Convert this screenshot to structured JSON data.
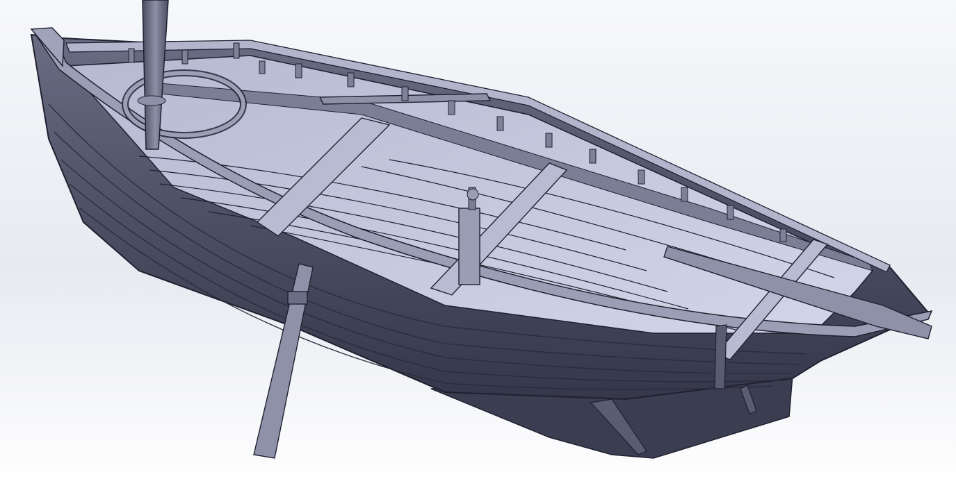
{
  "viewport": {
    "model": "boat",
    "view": "3d-shaded",
    "background": "gradient",
    "colors": {
      "hull_dark": "#3d3f52",
      "hull_mid": "#5b5e73",
      "hull_light": "#8e91a8",
      "deck": "#c9cbe0",
      "deck_shadow": "#a9abc2",
      "edge": "#1f2030",
      "background_top": "#f7f8fb",
      "background_bottom": "#ffffff"
    },
    "parts": [
      "hull",
      "deck-planking",
      "gunwale",
      "mast",
      "thwarts",
      "oars",
      "tholepins",
      "rudder-post",
      "keel"
    ]
  }
}
